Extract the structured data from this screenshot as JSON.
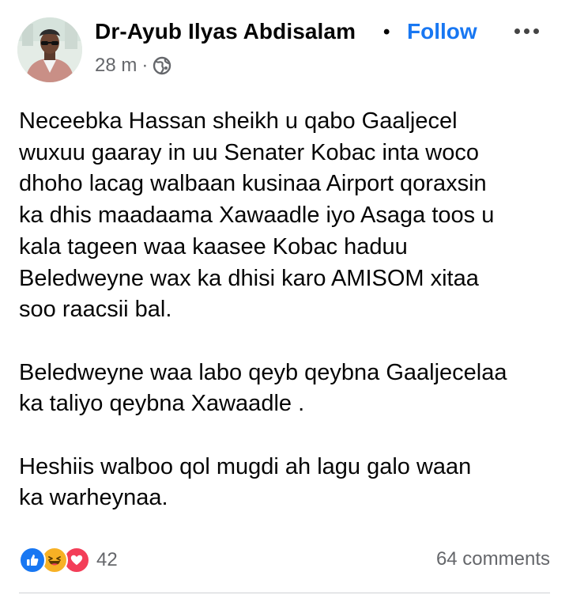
{
  "post": {
    "author": "Dr-Ayub Ilyas Abdisalam",
    "separator": "•",
    "follow_label": "Follow",
    "time": "28 m",
    "meta_dot": "·",
    "privacy_icon": "globe-icon",
    "paragraphs": [
      [
        "Neceebka Hassan sheikh u qabo Gaaljecel",
        "wuxuu gaaray in uu Senater Kobac inta woco",
        "dhoho lacag walbaan kusinaa Airport qoraxsin",
        "ka dhis maadaama Xawaadle iyo Asaga toos u",
        "kala tageen waa kaasee Kobac haduu",
        "Beledweyne wax ka dhisi karo AMISOM xitaa",
        "soo raacsii bal."
      ],
      [
        "Beledweyne waa labo qeyb qeybna Gaaljecelaa",
        "ka taliyo qeybna Xawaadle ."
      ],
      [
        "Heshiis walboo qol mugdi ah lagu galo waan",
        "ka warheynaa."
      ]
    ]
  },
  "footer": {
    "reaction_icons": [
      "like-icon",
      "haha-icon",
      "love-icon"
    ],
    "reaction_count": "42",
    "comments_label": "64 comments"
  },
  "colors": {
    "accent": "#1877f2",
    "secondary_text": "#65676b",
    "like": "#1877f2",
    "haha": "#f7b125",
    "love": "#f33e58"
  }
}
